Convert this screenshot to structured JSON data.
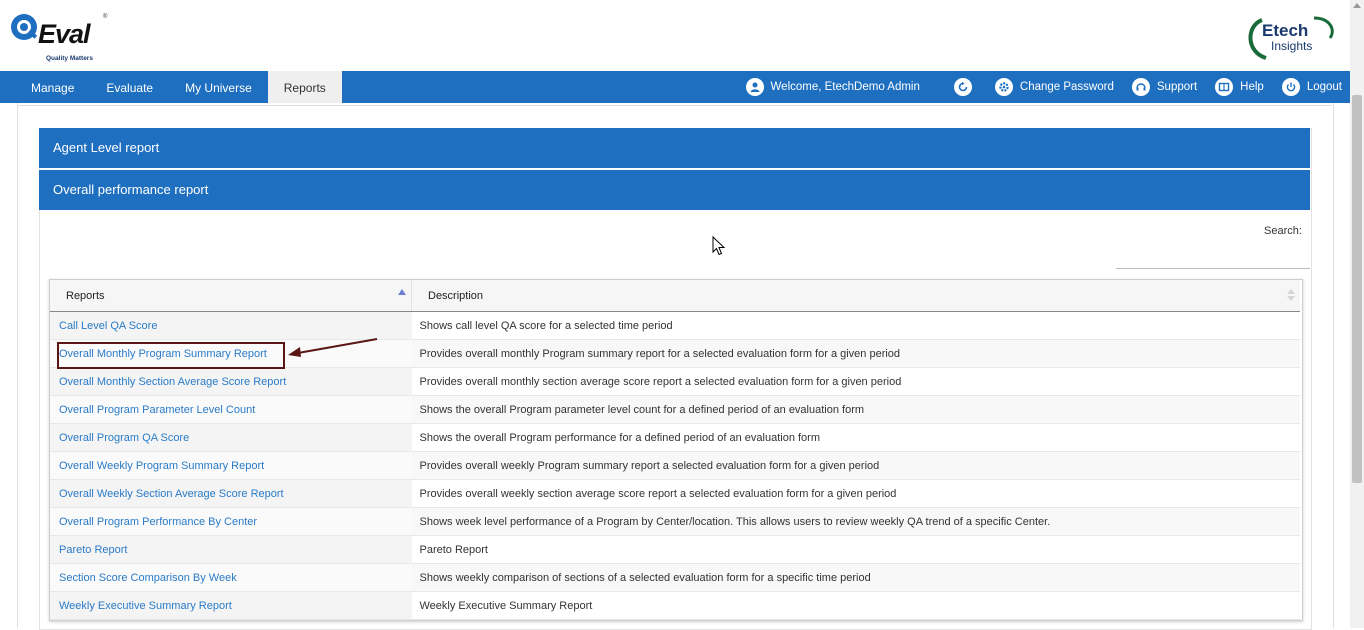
{
  "header": {
    "qeval_logo": {
      "name": "QEval",
      "tagline": "Quality Matters"
    },
    "etech_logo": {
      "line1": "Etech",
      "line2": "Insights"
    }
  },
  "nav": {
    "items": [
      {
        "label": "Manage",
        "active": false
      },
      {
        "label": "Evaluate",
        "active": false
      },
      {
        "label": "My Universe",
        "active": false
      },
      {
        "label": "Reports",
        "active": true
      }
    ],
    "welcome": "Welcome, EtechDemo Admin",
    "change_password": "Change Password",
    "support": "Support",
    "help": "Help",
    "logout": "Logout"
  },
  "panels": {
    "agent_level": "Agent Level report",
    "overall_performance": "Overall performance report"
  },
  "search": {
    "label": "Search:",
    "value": ""
  },
  "table": {
    "headers": {
      "reports": "Reports",
      "description": "Description"
    },
    "rows": [
      {
        "report": "Call Level QA Score",
        "description": "Shows call level QA score for a selected time period"
      },
      {
        "report": "Overall Monthly Program Summary Report",
        "description": "Provides overall monthly Program summary report for a selected evaluation form for a given period"
      },
      {
        "report": "Overall Monthly Section Average Score Report",
        "description": "Provides overall monthly section average score report a selected evaluation form for a given period"
      },
      {
        "report": "Overall Program Parameter Level Count",
        "description": "Shows the overall Program parameter level count for a defined period of an evaluation form"
      },
      {
        "report": "Overall Program QA Score",
        "description": "Shows the overall Program performance for a defined period of an evaluation form"
      },
      {
        "report": "Overall Weekly Program Summary Report",
        "description": "Provides overall weekly Program summary report a selected evaluation form for a given period"
      },
      {
        "report": "Overall Weekly Section Average Score Report",
        "description": "Provides overall weekly section average score report a selected evaluation form for a given period"
      },
      {
        "report": "Overall Program Performance By Center",
        "description": "Shows week level performance of a Program by Center/location. This allows users to review weekly QA trend of a specific Center."
      },
      {
        "report": "Pareto Report",
        "description": "Pareto Report"
      },
      {
        "report": "Section Score Comparison By Week",
        "description": "Shows weekly comparison of sections of a selected evaluation form for a specific time period"
      },
      {
        "report": "Weekly Executive Summary Report",
        "description": "Weekly Executive Summary Report"
      }
    ]
  },
  "colors": {
    "nav_blue": "#1f6fc0",
    "link_blue": "#2a7bc8",
    "highlight": "#5a1515"
  },
  "icons": {
    "user": "user-circle-icon",
    "refresh": "refresh-icon",
    "gear": "gear-icon",
    "support": "headset-icon",
    "help": "book-icon",
    "logout": "power-icon"
  }
}
